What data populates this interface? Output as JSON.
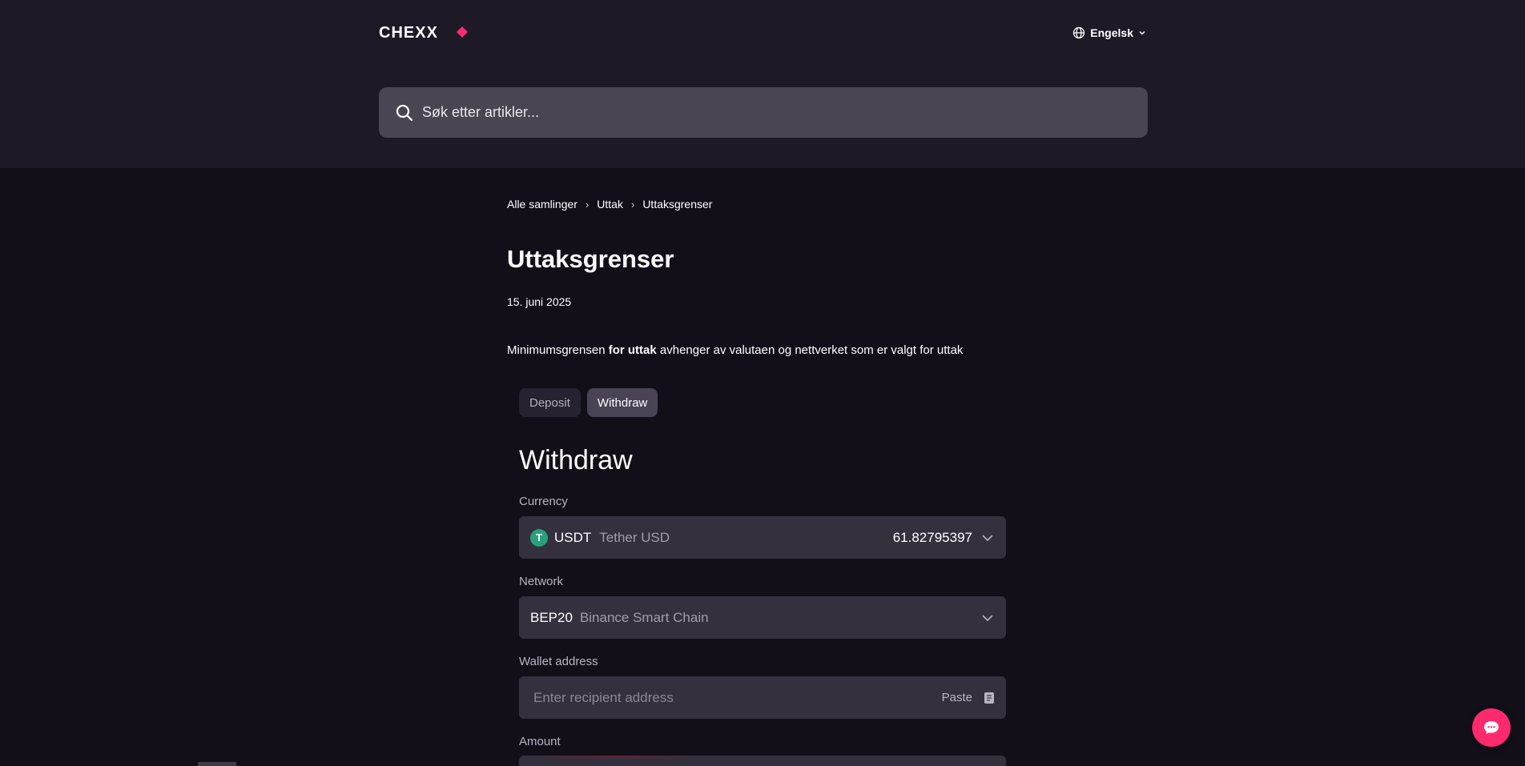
{
  "header": {
    "logo_text": "CHEXX",
    "language": "Engelsk"
  },
  "search": {
    "placeholder": "Søk etter artikler..."
  },
  "breadcrumb": {
    "items": [
      "Alle samlinger",
      "Uttak",
      "Uttaksgrenser"
    ],
    "separator": "›"
  },
  "article": {
    "title": "Uttaksgrenser",
    "date": "15. juni 2025",
    "intro_before": "Minimumsgrensen ",
    "intro_bold": "for uttak",
    "intro_after": " avhenger av valutaen og nettverket som er valgt for uttak"
  },
  "widget": {
    "tabs": [
      {
        "label": "Deposit",
        "active": false
      },
      {
        "label": "Withdraw",
        "active": true
      }
    ],
    "title": "Withdraw",
    "currency": {
      "label": "Currency",
      "symbol": "USDT",
      "name": "Tether USD",
      "icon_letter": "T",
      "balance": "61.82795397"
    },
    "network": {
      "label": "Network",
      "code": "BEP20",
      "name": "Binance Smart Chain"
    },
    "wallet": {
      "label": "Wallet address",
      "placeholder": "Enter recipient address",
      "paste_label": "Paste"
    },
    "amount": {
      "label": "Amount"
    }
  },
  "colors": {
    "page_bg": "#120f19",
    "header_bg": "#1d1927",
    "field_bg": "#35303e",
    "accent": "#ff2a6d",
    "tether": "#26a17b"
  },
  "icons": [
    "globe-icon",
    "chevron-down-icon",
    "search-icon",
    "clipboard-icon",
    "chat-icon"
  ]
}
